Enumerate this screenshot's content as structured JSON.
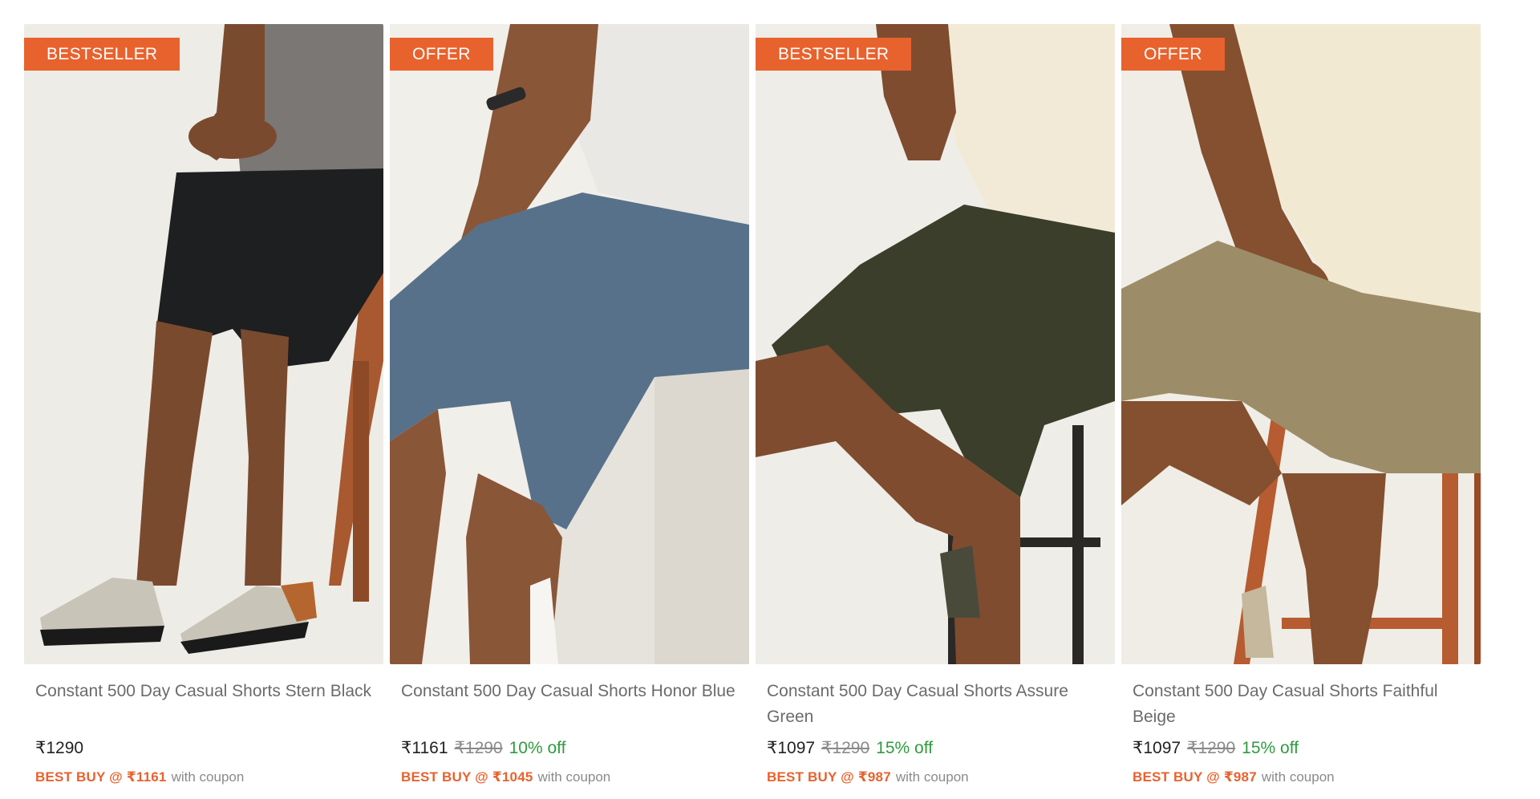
{
  "products": [
    {
      "tag": "BESTSELLER",
      "title": "Constant 500 Day Casual Shorts Stern Black",
      "price": "₹1290",
      "mrp": "",
      "discount": "",
      "best_buy": "BEST BUY @ ₹1161",
      "coupon_note": "with coupon",
      "colors": {
        "bg": "#eeece6",
        "shirt": "#7a7775",
        "shorts": "#1d1f20",
        "skin": "#7a4a2f",
        "seat": "#a8592f"
      }
    },
    {
      "tag": "OFFER",
      "title": "Constant 500 Day Casual Shorts Honor Blue",
      "price": "₹1161",
      "mrp": "₹1290",
      "discount": "10% off",
      "best_buy": "BEST BUY @ ₹1045",
      "coupon_note": "with coupon",
      "colors": {
        "bg": "#f1efea",
        "shirt": "#e9e8e4",
        "shorts": "#58718b",
        "skin": "#8a5638",
        "seat": "#eceae4"
      }
    },
    {
      "tag": "BESTSELLER",
      "title": "Constant 500 Day Casual Shorts Assure Green",
      "price": "₹1097",
      "mrp": "₹1290",
      "discount": "15% off",
      "best_buy": "BEST BUY @ ₹987",
      "coupon_note": "with coupon",
      "colors": {
        "bg": "#efede7",
        "shirt": "#f2ead7",
        "shorts": "#3b3e2a",
        "skin": "#7f4c30",
        "seat": "#2b2926"
      }
    },
    {
      "tag": "OFFER",
      "title": "Constant 500 Day Casual Shorts Faithful Beige",
      "price": "₹1097",
      "mrp": "₹1290",
      "discount": "15% off",
      "best_buy": "BEST BUY @ ₹987",
      "coupon_note": "with coupon",
      "colors": {
        "bg": "#efede6",
        "shirt": "#f2e9d3",
        "shorts": "#9c8d68",
        "skin": "#84502f",
        "seat": "#b75b30"
      }
    }
  ]
}
